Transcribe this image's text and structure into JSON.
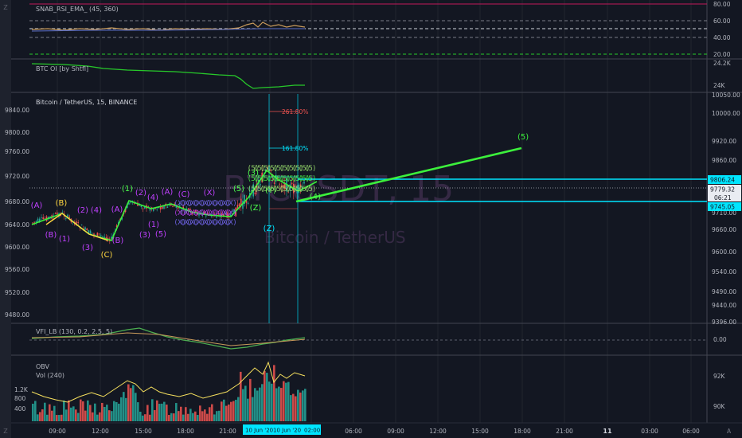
{
  "colors": {
    "background": "#131722",
    "grid": "#2a2e39",
    "candle_up": "#26a69a",
    "candle_down": "#ef5350",
    "wave_line": "#3cf03c",
    "fib_blue": "#00e5ff",
    "fib_red": "#ef5350",
    "rsi_line": "#c99b5b",
    "oi_line": "#27c92a",
    "vfi_line": "#4caf50",
    "obv_line": "#f6e05e",
    "wave_purple": "#c040ff",
    "wave_yellow": "#ffd740",
    "wave_green": "#4cff4c"
  },
  "panes": {
    "rsi": {
      "label": "SNAB_RSI_EMA_ (45, 360)",
      "ticks": [
        "80.00",
        "60.00",
        "40.00",
        "20.00"
      ],
      "levels": [
        80,
        60,
        50,
        40,
        20
      ]
    },
    "oi": {
      "label": "BTC OI [by Shtfl]",
      "ticks": [
        "24.2K",
        "24K"
      ]
    },
    "main": {
      "label": "Bitcoin / TetherUS, 15, BINANCE",
      "watermark_big": "BTCUSDT, 15",
      "watermark_small": "Bitcoin / TetherUS",
      "left_ticks": [
        "9840.00",
        "9800.00",
        "9760.00",
        "9720.00",
        "9680.00",
        "9640.00",
        "9600.00",
        "9560.00",
        "9520.00",
        "9480.00"
      ],
      "right_ticks": [
        "10050.00",
        "10000.00",
        "9920.00",
        "9860.00",
        "9710.00",
        "9660.00",
        "9600.00",
        "9540.00",
        "9490.00",
        "9440.00",
        "9396.00"
      ],
      "price_tags": [
        {
          "value": "9806.24",
          "style": "cyan"
        },
        {
          "value": "9779.32",
          "style": "dark"
        },
        {
          "value": "06:21",
          "style": "dark"
        },
        {
          "value": "9745.05",
          "style": "cyan"
        }
      ],
      "fib_labels": [
        {
          "text": "261.80%",
          "color": "red"
        },
        {
          "text": "161.80%",
          "color": "blue"
        }
      ],
      "target_label": "(5)"
    },
    "vfi": {
      "label": "VFI_LB (130, 0.2, 2.5, 5)",
      "ticks": [
        "0.00"
      ]
    },
    "obv": {
      "label_1": "OBV",
      "label_2": "Vol (240)",
      "left_ticks": [
        "1.2K",
        "800",
        "400"
      ],
      "right_ticks": [
        "92K",
        "90K"
      ]
    }
  },
  "time_axis": {
    "labels": [
      "09:00",
      "12:00",
      "15:00",
      "18:00",
      "21:00",
      "06:00",
      "09:00",
      "12:00",
      "15:00",
      "18:00",
      "21:00",
      "11",
      "03:00",
      "06:00"
    ],
    "highlight_left": "10 Jun '20",
    "highlight_right": "10 Jun '20",
    "highlight_end": "02:00"
  },
  "left_toolbar": {
    "top_label": "Z",
    "bottom_label": "Z"
  },
  "auto_button": "A",
  "wave_labels": [
    {
      "text": "(A)",
      "color": "purple"
    },
    {
      "text": "(B)",
      "color": "yellow"
    },
    {
      "text": "(B)",
      "color": "purple"
    },
    {
      "text": "(1)",
      "color": "purple"
    },
    {
      "text": "(2)",
      "color": "purple"
    },
    {
      "text": "(4)",
      "color": "purple"
    },
    {
      "text": "(3)",
      "color": "purple"
    },
    {
      "text": "(B)",
      "color": "purple"
    },
    {
      "text": "(C)",
      "color": "yellow"
    },
    {
      "text": "(A)",
      "color": "purple"
    },
    {
      "text": "(1)",
      "color": "green"
    },
    {
      "text": "(2)",
      "color": "purple"
    },
    {
      "text": "(4)",
      "color": "purple"
    },
    {
      "text": "(A)",
      "color": "purple"
    },
    {
      "text": "(1)",
      "color": "purple"
    },
    {
      "text": "(3)",
      "color": "purple"
    },
    {
      "text": "(5)",
      "color": "purple"
    },
    {
      "text": "(C)",
      "color": "purple"
    },
    {
      "text": "(X)",
      "color": "purple"
    },
    {
      "text": "(5)",
      "color": "green"
    },
    {
      "text": "(3)",
      "color": "green"
    },
    {
      "text": "(Z)",
      "color": "green"
    },
    {
      "text": "(Z)",
      "color": "blue"
    },
    {
      "text": "(Y)",
      "color": "green"
    },
    {
      "text": "(4)",
      "color": "green"
    }
  ]
}
